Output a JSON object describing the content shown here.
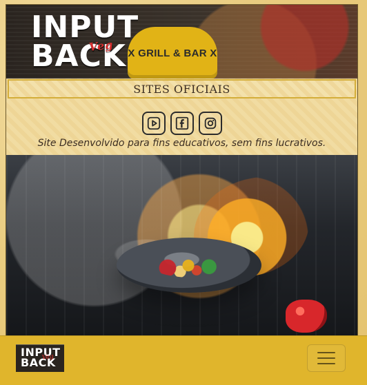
{
  "header": {
    "logo": {
      "line1": "INPUT",
      "line2": "BACK",
      "script": "Veg"
    },
    "badge_text": "X GRILL & BAR X"
  },
  "sites": {
    "title": "SITES OFICIAIS",
    "icons": [
      {
        "name": "youtube-icon"
      },
      {
        "name": "facebook-icon"
      },
      {
        "name": "instagram-icon"
      }
    ],
    "disclaimer": "Site Desenvolvido para fins educativos, sem fins lucrativos."
  },
  "navbar": {
    "logo": {
      "line1": "INPUT",
      "line2": "BACK",
      "script": "Veg"
    }
  },
  "colors": {
    "navbar_bg": "#e0b52c",
    "badge": "#e1b316"
  }
}
